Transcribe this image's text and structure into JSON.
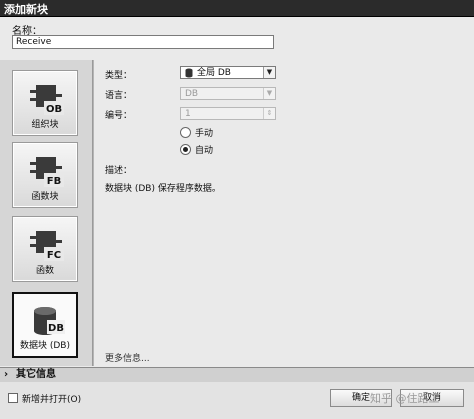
{
  "window": {
    "title": "添加新块"
  },
  "name": {
    "label": "名称：",
    "value": "Receive"
  },
  "blocks": [
    {
      "label": "组织块",
      "badge": "OB",
      "selected": false
    },
    {
      "label": "函数块",
      "badge": "FB",
      "selected": false
    },
    {
      "label": "函数",
      "badge": "FC",
      "selected": false
    },
    {
      "label": "数据块 (DB)",
      "badge": "DB",
      "selected": true
    }
  ],
  "form": {
    "type_label": "类型：",
    "type_value": "全局 DB",
    "language_label": "语言：",
    "language_value": "DB",
    "number_label": "编号：",
    "number_value": "1",
    "radio_manual": "手动",
    "radio_auto": "自动",
    "selected_radio": "auto"
  },
  "description": {
    "label": "描述：",
    "text": "数据块 (DB) 保存程序数据。"
  },
  "more_info": "更多信息...",
  "other_info": "其它信息",
  "footer": {
    "checkbox_label": "新增并打开(O)",
    "ok_label": "确定",
    "cancel_label": "取消"
  },
  "watermark": "知乎 @住路工"
}
